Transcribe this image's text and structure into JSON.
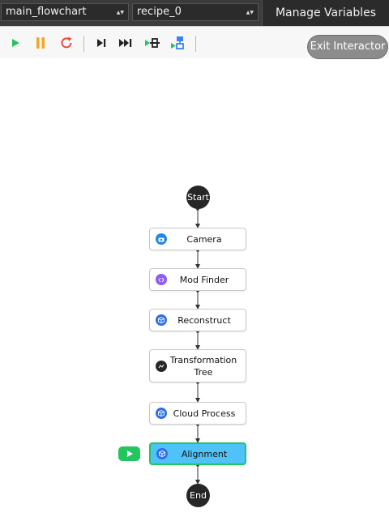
{
  "topbar": {
    "flowchart_select": "main_flowchart",
    "recipe_select": "recipe_0",
    "manage_variables_label": "Manage Variables"
  },
  "toolbar": {
    "icons": [
      "play-icon",
      "pause-icon",
      "restart-icon",
      "step-icon",
      "fast-forward-icon",
      "step-into-icon",
      "step-over-icon"
    ],
    "exit_label": "Exit Interactor"
  },
  "colors": {
    "accent_green": "#22c55e",
    "active_node": "#4fc3f7",
    "pause_orange": "#f5a623",
    "restart_red": "#e74c3c"
  },
  "flowchart": {
    "start_label": "Start",
    "end_label": "End",
    "nodes": [
      {
        "label": "Camera",
        "icon": "camera-icon",
        "icon_color": "#1e88e5"
      },
      {
        "label": "Mod Finder",
        "icon": "code-icon",
        "icon_color": "#8b5cf6"
      },
      {
        "label": "Reconstruct",
        "icon": "cube-icon",
        "icon_color": "#2f6fe8"
      },
      {
        "label": "Transformation Tree",
        "icon": "tree-icon",
        "icon_color": "#262626"
      },
      {
        "label": "Cloud Process",
        "icon": "cube-icon",
        "icon_color": "#2f6fe8"
      },
      {
        "label": "Alignment",
        "icon": "cube-icon",
        "icon_color": "#2f6fe8",
        "active": true
      }
    ]
  }
}
